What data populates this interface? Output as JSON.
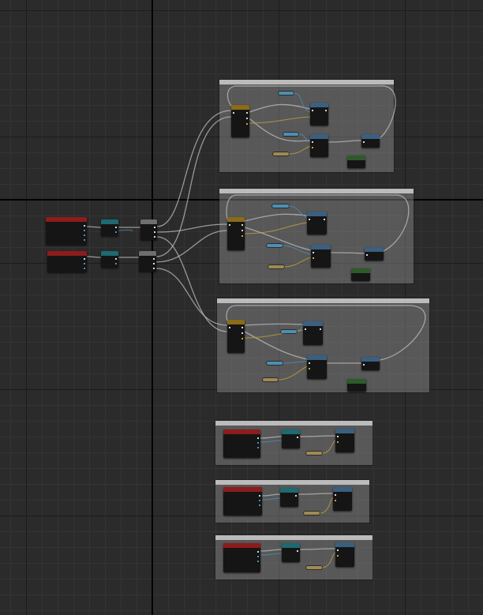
{
  "canvas": {
    "background": "#2b2b2b",
    "grid_minor": "#343434",
    "grid_major": "#1c1c1c",
    "origin_axes": "#000000"
  },
  "comments": [
    {
      "id": "comment-group-1",
      "title": ""
    },
    {
      "id": "comment-group-2",
      "title": ""
    },
    {
      "id": "comment-group-3",
      "title": ""
    },
    {
      "id": "comment-group-4",
      "title": ""
    },
    {
      "id": "comment-group-5",
      "title": ""
    },
    {
      "id": "comment-group-6",
      "title": ""
    }
  ],
  "node_colors": {
    "event": "#8d1c1c",
    "pure_function": "#1d6a70",
    "sequence": "#6f6f6f",
    "flow_macro": "#8a6b17",
    "function_call": "#3b5f80",
    "action": "#2f5a2c",
    "variable_object": "#4d8fb3",
    "variable_value": "#a08a54"
  },
  "wire_colors": {
    "exec": "#bdbdbd",
    "object": "#4d8fb3",
    "value": "#c9a53a"
  }
}
